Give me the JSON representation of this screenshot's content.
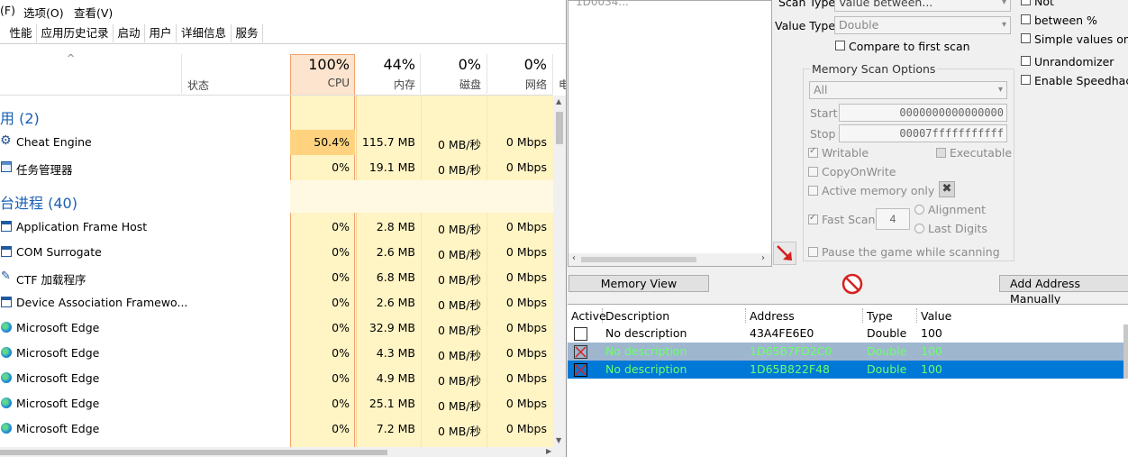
{
  "taskmanager": {
    "menu": [
      "(F)",
      "选项(O)",
      "查看(V)"
    ],
    "tabs": [
      "性能",
      "应用历史记录",
      "启动",
      "用户",
      "详细信息",
      "服务"
    ],
    "columns": {
      "status": "状态",
      "cpu": {
        "pct": "100%",
        "label": "CPU"
      },
      "memory": {
        "pct": "44%",
        "label": "内存"
      },
      "disk": {
        "pct": "0%",
        "label": "磁盘"
      },
      "network": {
        "pct": "0%",
        "label": "网络"
      },
      "extra": "电"
    },
    "groups": {
      "apps": "用 (2)",
      "background": "台进程 (40)"
    },
    "apps": [
      {
        "name": "Cheat Engine",
        "cpu": "50.4%",
        "mem": "115.7 MB",
        "disk": "0 MB/秒",
        "net": "0 Mbps",
        "icon": "gear-icon"
      },
      {
        "name": "任务管理器",
        "cpu": "0%",
        "mem": "19.1 MB",
        "disk": "0 MB/秒",
        "net": "0 Mbps",
        "icon": "taskmgr-icon"
      }
    ],
    "processes": [
      {
        "name": "Application Frame Host",
        "cpu": "0%",
        "mem": "2.8 MB",
        "disk": "0 MB/秒",
        "net": "0 Mbps",
        "icon": "window-icon"
      },
      {
        "name": "COM Surrogate",
        "cpu": "0%",
        "mem": "2.6 MB",
        "disk": "0 MB/秒",
        "net": "0 Mbps",
        "icon": "window-icon"
      },
      {
        "name": "CTF 加载程序",
        "cpu": "0%",
        "mem": "6.8 MB",
        "disk": "0 MB/秒",
        "net": "0 Mbps",
        "icon": "pen-icon"
      },
      {
        "name": "Device Association Framewo...",
        "cpu": "0%",
        "mem": "2.6 MB",
        "disk": "0 MB/秒",
        "net": "0 Mbps",
        "icon": "window-icon"
      },
      {
        "name": "Microsoft Edge",
        "cpu": "0%",
        "mem": "32.9 MB",
        "disk": "0 MB/秒",
        "net": "0 Mbps",
        "icon": "edge-icon"
      },
      {
        "name": "Microsoft Edge",
        "cpu": "0%",
        "mem": "4.3 MB",
        "disk": "0 MB/秒",
        "net": "0 Mbps",
        "icon": "edge-icon"
      },
      {
        "name": "Microsoft Edge",
        "cpu": "0%",
        "mem": "4.9 MB",
        "disk": "0 MB/秒",
        "net": "0 Mbps",
        "icon": "edge-icon"
      },
      {
        "name": "Microsoft Edge",
        "cpu": "0%",
        "mem": "25.1 MB",
        "disk": "0 MB/秒",
        "net": "0 Mbps",
        "icon": "edge-icon"
      },
      {
        "name": "Microsoft Edge",
        "cpu": "0%",
        "mem": "7.2 MB",
        "disk": "0 MB/秒",
        "net": "0 Mbps",
        "icon": "edge-icon"
      }
    ]
  },
  "cheatengine": {
    "list_partial": "1D0034...",
    "scan_type_label": "Scan Type",
    "scan_type_value": "Value between...",
    "value_type_label": "Value Type",
    "value_type_value": "Double",
    "compare_first": "Compare to first scan",
    "not_label": "Not",
    "between_pct": "between %",
    "simple_values": "Simple values only",
    "unrandomizer": "Unrandomizer",
    "speedhack": "Enable Speedhack",
    "mso_title": "Memory Scan Options",
    "mso_region": "All",
    "start_label": "Start",
    "start_value": "0000000000000000",
    "stop_label": "Stop",
    "stop_value": "00007fffffffffff",
    "writable": "Writable",
    "executable": "Executable",
    "copyonwrite": "CopyOnWrite",
    "active_memory": "Active memory only",
    "fast_scan": "Fast Scan",
    "fast_scan_value": "4",
    "alignment": "Alignment",
    "last_digits": "Last Digits",
    "pause_game": "Pause the game while scanning",
    "memory_view": "Memory View",
    "add_address": "Add Address Manually",
    "table_headers": {
      "active": "Active",
      "description": "Description",
      "address": "Address",
      "type": "Type",
      "value": "Value"
    },
    "rows": [
      {
        "description": "No description",
        "address": "43A4FE6E0",
        "type": "Double",
        "value": "100",
        "active": false,
        "state": "normal"
      },
      {
        "description": "No description",
        "address": "1D65B7FD2C0",
        "type": "Double",
        "value": "100",
        "active": true,
        "state": "selected-inactive"
      },
      {
        "description": "No description",
        "address": "1D65B822F48",
        "type": "Double",
        "value": "100",
        "active": true,
        "state": "selected"
      }
    ],
    "colors": {
      "selected": "#0078d7",
      "selected_inactive": "#9fb6cf",
      "frozen_text": "#6cff6c"
    }
  }
}
